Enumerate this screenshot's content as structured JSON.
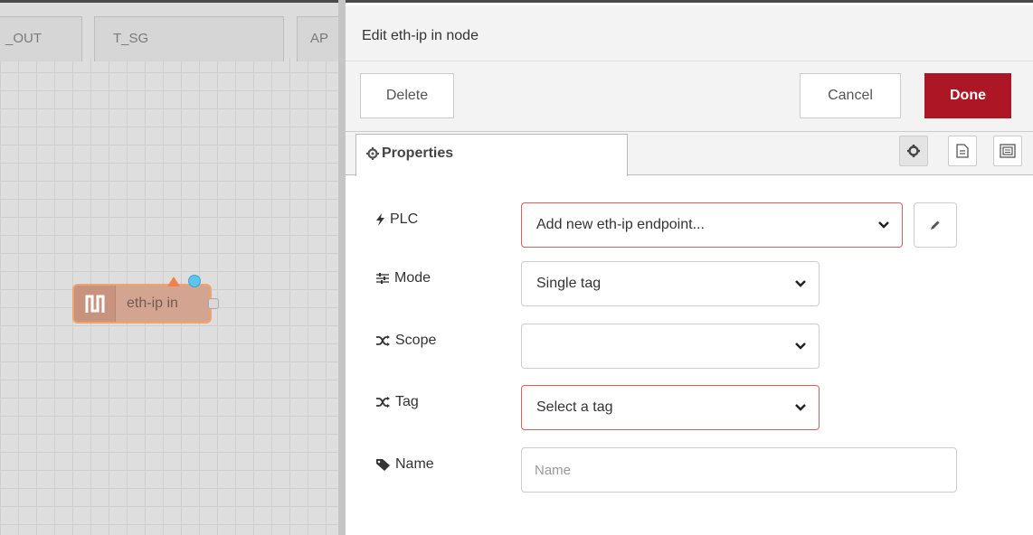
{
  "workspace": {
    "tabs": [
      {
        "label": "_OUT"
      },
      {
        "label": "T_SG"
      },
      {
        "label": "AP"
      }
    ],
    "node": {
      "label": "eth-ip in"
    }
  },
  "editor": {
    "title": "Edit eth-ip in node",
    "buttons": {
      "delete": "Delete",
      "cancel": "Cancel",
      "done": "Done"
    },
    "tabs": [
      {
        "label": "Properties",
        "icon": "gear-icon"
      }
    ],
    "side_buttons": [
      "gear-icon",
      "description-icon",
      "appearance-icon"
    ],
    "form": {
      "plc": {
        "label": "PLC",
        "icon": "bolt-icon",
        "value": "Add new eth-ip endpoint..."
      },
      "mode": {
        "label": "Mode",
        "icon": "sliders-icon",
        "value": "Single tag"
      },
      "scope": {
        "label": "Scope",
        "icon": "shuffle-icon",
        "value": ""
      },
      "tag": {
        "label": "Tag",
        "icon": "shuffle-icon",
        "value": "Select a tag"
      },
      "name": {
        "label": "Name",
        "icon": "tag-icon",
        "value": "",
        "placeholder": "Name"
      }
    }
  },
  "colors": {
    "done_button": "#ad1625",
    "error_border": "#d6615f",
    "node_fill": "#d3a591",
    "node_border": "#f0a46b",
    "node_warning": "#f0824a",
    "node_changed": "#5ec3ee"
  }
}
